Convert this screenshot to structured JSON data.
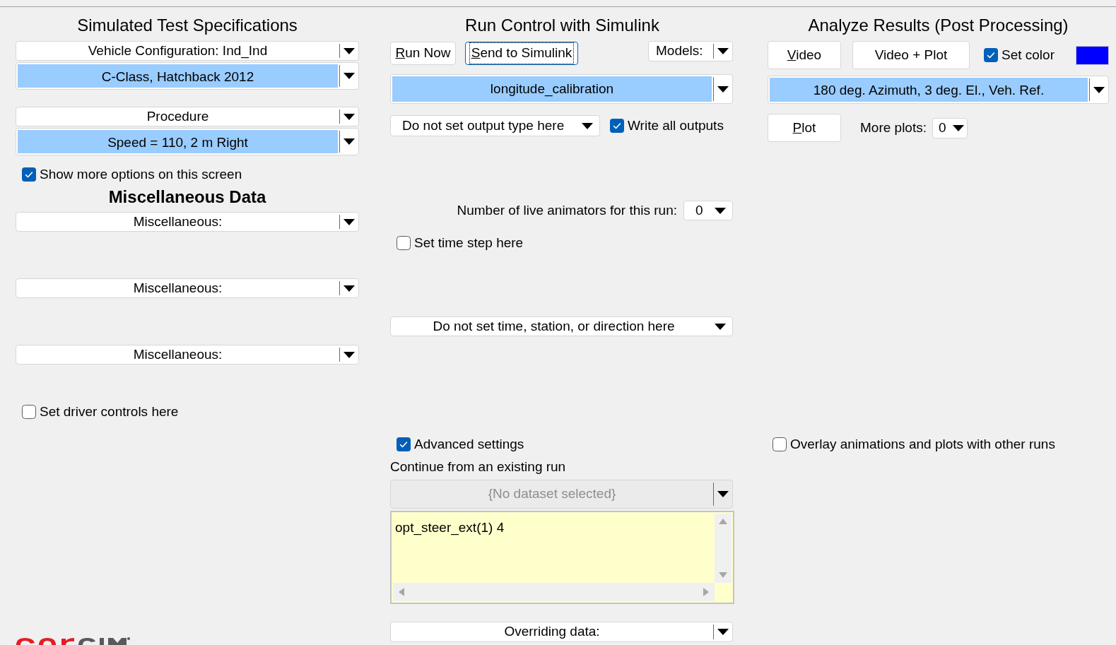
{
  "sim_specs": {
    "title": "Simulated Test Specifications",
    "vehicle": {
      "category": "Vehicle Configuration: Ind_Ind",
      "dataset": "C-Class, Hatchback 2012"
    },
    "procedure": {
      "category": "Procedure",
      "dataset": "Speed = 110, 2 m Right"
    },
    "show_more_options": {
      "label": "Show more options on this screen",
      "checked": true
    }
  },
  "misc_data": {
    "title": "Miscellaneous Data",
    "selectors": [
      "Miscellaneous:",
      "Miscellaneous:",
      "Miscellaneous:"
    ],
    "driver_controls": {
      "label": "Set driver controls here",
      "checked": false
    }
  },
  "run_control": {
    "title": "Run Control with Simulink",
    "buttons": [
      {
        "label": "Run Now",
        "mnemonic": true,
        "focused": false
      },
      {
        "label": "Send to Simulink",
        "mnemonic": true,
        "focused": true
      }
    ],
    "models": "Models:",
    "model": "longitude_calibration",
    "output_type": "Do not set output type here",
    "write_all_outputs": {
      "label": "Write all outputs",
      "checked": true
    },
    "live_animators": {
      "label": "Number of live animators for this run:",
      "value": "0"
    },
    "time_step": {
      "label": "Set time step here",
      "checked": false
    },
    "time_station": "Do not set time, station, or direction here",
    "advanced_settings": {
      "label": "Advanced settings",
      "checked": true
    },
    "continue_label": "Continue from an existing run",
    "existing_run": {
      "value": "{No dataset selected}",
      "disabled": true
    },
    "misc_text": {
      "value": "opt_steer_ext(1) 4"
    },
    "overriding": "Overriding data:"
  },
  "analyze": {
    "title": "Analyze Results (Post Processing)",
    "buttons": [
      {
        "label": "Video",
        "mnemonic": true
      },
      {
        "label": "Video + Plot",
        "mnemonic": false
      }
    ],
    "set_color": {
      "label": "Set color",
      "checked": true,
      "color": "#0000ff"
    },
    "camera": "180 deg. Azimuth, 3 deg. El., Veh. Ref.",
    "plot_button": {
      "label": "Plot",
      "mnemonic": true
    },
    "more_plots": {
      "label": "More plots:",
      "value": "0"
    },
    "overlay": {
      "label": "Overlay animations and plots with other runs",
      "checked": false
    }
  }
}
